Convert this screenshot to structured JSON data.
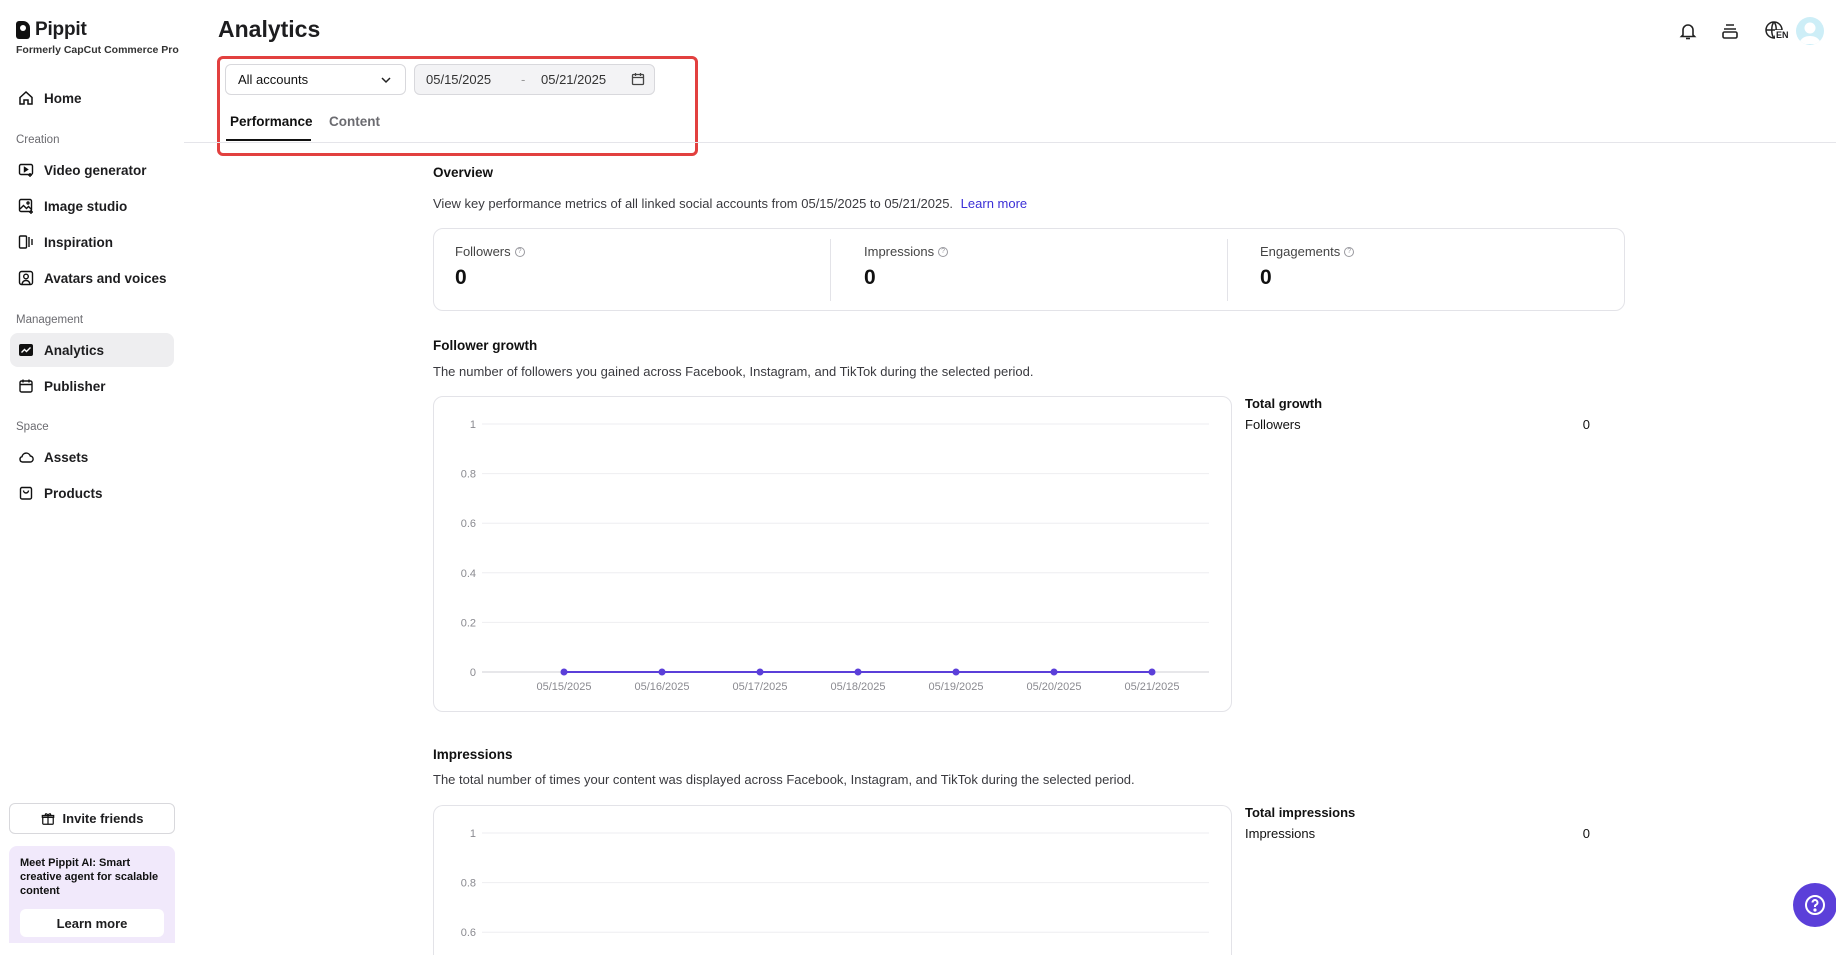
{
  "app": {
    "logo_name": "Pippit",
    "subtitle": "Formerly CapCut Commerce Pro"
  },
  "sidebar": {
    "home": "Home",
    "sections": {
      "creation": "Creation",
      "management": "Management",
      "space": "Space"
    },
    "creation_items": [
      {
        "label": "Video generator",
        "icon": "video-plus-icon"
      },
      {
        "label": "Image studio",
        "icon": "image-plus-icon"
      },
      {
        "label": "Inspiration",
        "icon": "inspiration-icon"
      },
      {
        "label": "Avatars and voices",
        "icon": "avatar-icon"
      }
    ],
    "management_items": [
      {
        "label": "Analytics",
        "icon": "analytics-icon",
        "active": true
      },
      {
        "label": "Publisher",
        "icon": "calendar-icon"
      }
    ],
    "space_items": [
      {
        "label": "Assets",
        "icon": "cloud-icon"
      },
      {
        "label": "Products",
        "icon": "bag-icon"
      }
    ],
    "invite_label": "Invite friends",
    "promo": {
      "text": "Meet Pippit AI: Smart creative agent for scalable content",
      "button": "Learn more"
    }
  },
  "header": {
    "title": "Analytics",
    "language_badge": "EN"
  },
  "filters": {
    "account_value": "All accounts",
    "date_start": "05/15/2025",
    "date_separator": "-",
    "date_end": "05/21/2025"
  },
  "tabs": [
    {
      "label": "Performance",
      "active": true
    },
    {
      "label": "Content",
      "active": false
    }
  ],
  "overview": {
    "title": "Overview",
    "description": "View key performance metrics of all linked social accounts from 05/15/2025 to 05/21/2025.",
    "link": "Learn more",
    "metrics": [
      {
        "label": "Followers",
        "value": "0"
      },
      {
        "label": "Impressions",
        "value": "0"
      },
      {
        "label": "Engagements",
        "value": "0"
      }
    ]
  },
  "follower_growth": {
    "title": "Follower growth",
    "description": "The number of followers you gained across Facebook, Instagram, and TikTok during the selected period.",
    "total_title": "Total growth",
    "total_label": "Followers",
    "total_value": "0"
  },
  "impressions": {
    "title": "Impressions",
    "description": "The total number of times your content was displayed across Facebook, Instagram, and TikTok during the selected period.",
    "total_title": "Total impressions",
    "total_label": "Impressions",
    "total_value": "0"
  },
  "colors": {
    "accent": "#5b3fd9",
    "highlight_border": "#e2403f",
    "link": "#3b2fd6"
  },
  "chart_data": [
    {
      "type": "line",
      "x": [
        "05/15/2025",
        "05/16/2025",
        "05/17/2025",
        "05/18/2025",
        "05/19/2025",
        "05/20/2025",
        "05/21/2025"
      ],
      "series": [
        {
          "values": [
            0,
            0,
            0,
            0,
            0,
            0,
            0
          ]
        }
      ],
      "yticks": [
        "1",
        "0.8",
        "0.6",
        "0.4",
        "0.2",
        "0"
      ],
      "ylim": [
        0,
        1
      ],
      "grid": true
    },
    {
      "type": "line",
      "x": [],
      "series": [],
      "yticks": [
        "1",
        "0.8",
        "0.6"
      ],
      "ylim": [
        0,
        1
      ],
      "grid": true
    }
  ]
}
